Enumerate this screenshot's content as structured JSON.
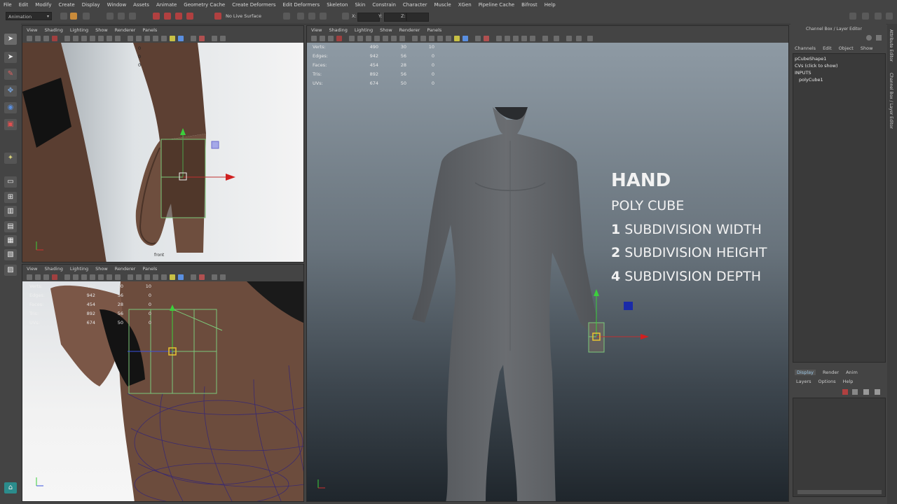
{
  "menubar": [
    "File",
    "Edit",
    "Modify",
    "Create",
    "Display",
    "Window",
    "Assets",
    "Animate",
    "Geometry Cache",
    "Create Deformers",
    "Edit Deformers",
    "Skeleton",
    "Skin",
    "Constrain",
    "Character",
    "Muscle",
    "XGen",
    "Pipeline Cache",
    "Bifrost",
    "Help"
  ],
  "status": {
    "mode": "Animation",
    "live_surface": "No Live Surface",
    "x": "X:",
    "y": "Y:",
    "z": "Z:"
  },
  "panel_menu": [
    "View",
    "Shading",
    "Lighting",
    "Show",
    "Renderer",
    "Panels"
  ],
  "hud": {
    "rows": [
      {
        "label": "Verts:",
        "a": "490",
        "b": "30",
        "c": "10"
      },
      {
        "label": "Edges:",
        "a": "942",
        "b": "56",
        "c": "0"
      },
      {
        "label": "Faces:",
        "a": "454",
        "b": "28",
        "c": "0"
      },
      {
        "label": "Tris:",
        "a": "892",
        "b": "56",
        "c": "0"
      },
      {
        "label": "UVs:",
        "a": "674",
        "b": "50",
        "c": "0"
      }
    ]
  },
  "front_label": "front",
  "overlay": {
    "title": "HAND",
    "subtitle": "POLY CUBE",
    "lines": [
      {
        "num": "1",
        "text": "SUBDIVISION WIDTH"
      },
      {
        "num": "2",
        "text": "SUBDIVISION HEIGHT"
      },
      {
        "num": "4",
        "text": "SUBDIVISION DEPTH"
      }
    ]
  },
  "channel_box": {
    "header": "Channel Box / Layer Editor",
    "menu": [
      "Channels",
      "Edit",
      "Object",
      "Show"
    ],
    "shape": "pCubeShape1",
    "cvs": "CVs (click to show)",
    "inputs": "INPUTS",
    "input_node": "polyCube1",
    "layer_tabs": [
      "Display",
      "Render",
      "Anim"
    ],
    "layer_menu": [
      "Layers",
      "Options",
      "Help"
    ],
    "side_tabs": [
      "Attribute Editor",
      "Channel Box / Layer Editor"
    ]
  },
  "colors": {
    "viewport_top": "#8e9aa4",
    "viewport_bottom": "#1f262c",
    "skin": "#6e4e3e",
    "ui_bg": "#444444"
  }
}
